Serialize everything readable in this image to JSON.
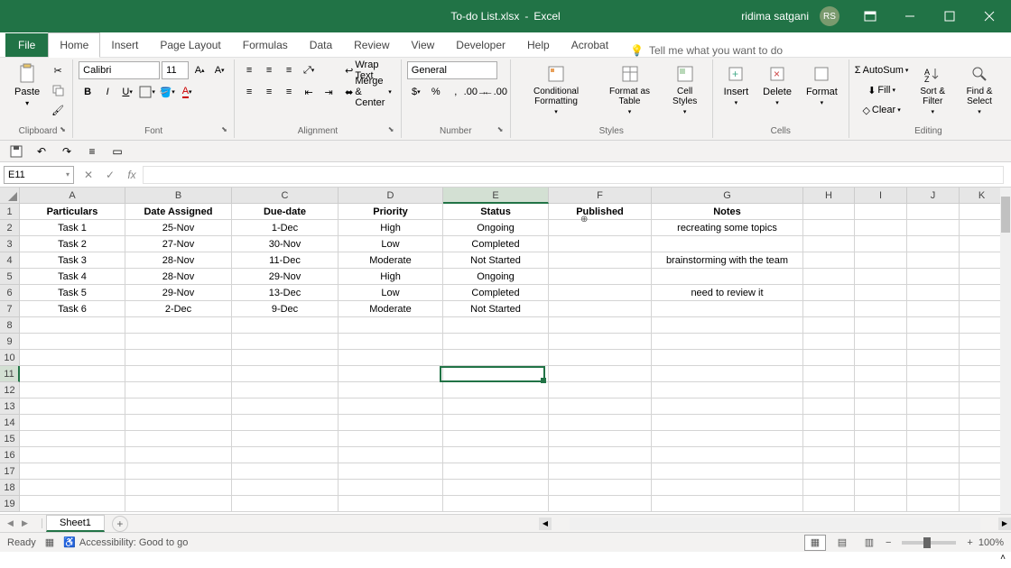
{
  "titlebar": {
    "filename": "To-do List.xlsx",
    "app": "Excel",
    "user": "ridima satgani",
    "initials": "RS"
  },
  "tabs": [
    "File",
    "Home",
    "Insert",
    "Page Layout",
    "Formulas",
    "Data",
    "Review",
    "View",
    "Developer",
    "Help",
    "Acrobat"
  ],
  "tell_me": "Tell me what you want to do",
  "ribbon": {
    "clipboard": {
      "label": "Clipboard",
      "paste": "Paste"
    },
    "font": {
      "label": "Font",
      "name": "Calibri",
      "size": "11"
    },
    "alignment": {
      "label": "Alignment",
      "wrap": "Wrap Text",
      "merge": "Merge & Center"
    },
    "number": {
      "label": "Number",
      "format": "General"
    },
    "styles": {
      "label": "Styles",
      "cond": "Conditional Formatting",
      "table": "Format as Table",
      "cell": "Cell Styles"
    },
    "cells": {
      "label": "Cells",
      "insert": "Insert",
      "delete": "Delete",
      "format": "Format"
    },
    "editing": {
      "label": "Editing",
      "autosum": "AutoSum",
      "fill": "Fill",
      "clear": "Clear",
      "sort": "Sort & Filter",
      "find": "Find & Select"
    }
  },
  "name_box": "E11",
  "columns": [
    "A",
    "B",
    "C",
    "D",
    "E",
    "F",
    "G",
    "H",
    "I",
    "J",
    "K"
  ],
  "headers": [
    "Particulars",
    "Date Assigned",
    "Due-date",
    "Priority",
    "Status",
    "Published",
    "Notes"
  ],
  "rows": [
    {
      "a": "Task 1",
      "b": "25-Nov",
      "c": "1-Dec",
      "d": "High",
      "e": "Ongoing",
      "f": "",
      "g": "recreating some topics"
    },
    {
      "a": "Task 2",
      "b": "27-Nov",
      "c": "30-Nov",
      "d": "Low",
      "e": "Completed",
      "f": "",
      "g": ""
    },
    {
      "a": "Task 3",
      "b": "28-Nov",
      "c": "11-Dec",
      "d": "Moderate",
      "e": "Not Started",
      "f": "",
      "g": "brainstorming with the team"
    },
    {
      "a": "Task 4",
      "b": "28-Nov",
      "c": "29-Nov",
      "d": "High",
      "e": "Ongoing",
      "f": "",
      "g": ""
    },
    {
      "a": "Task 5",
      "b": "29-Nov",
      "c": "13-Dec",
      "d": "Low",
      "e": "Completed",
      "f": "",
      "g": "need to review it"
    },
    {
      "a": "Task 6",
      "b": "2-Dec",
      "c": "9-Dec",
      "d": "Moderate",
      "e": "Not Started",
      "f": "",
      "g": ""
    }
  ],
  "sheet": "Sheet1",
  "status": {
    "ready": "Ready",
    "acc": "Accessibility: Good to go",
    "zoom": "100%"
  }
}
